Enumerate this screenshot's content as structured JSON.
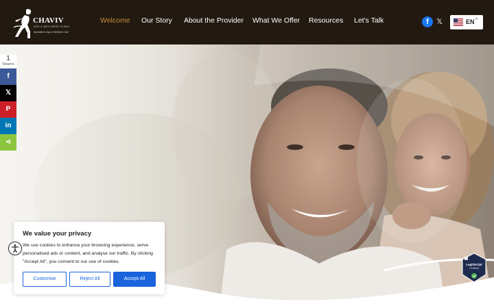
{
  "header": {
    "brand": "CHAVIV",
    "brand_sub1": "AGE & WELLNESS CLINIC",
    "brand_sub2": "Specialist in Age & Wellness Care",
    "nav": [
      {
        "label": "Welcome",
        "active": true
      },
      {
        "label": "Our Story",
        "active": false
      },
      {
        "label": "About the Provider",
        "active": false
      },
      {
        "label": "What We Offer",
        "active": false
      },
      {
        "label": "Resources",
        "active": false
      },
      {
        "label": "Let's Talk",
        "active": false
      }
    ],
    "social": {
      "facebook_glyph": "f",
      "x_glyph": "𝕏"
    },
    "language": {
      "code": "EN",
      "flag_icon": "us-flag-icon",
      "caret": "^"
    }
  },
  "share_bar": {
    "count": "1",
    "count_label": "Shares",
    "buttons": [
      {
        "icon": "facebook-icon",
        "glyph": "f",
        "color": "#3b5998"
      },
      {
        "icon": "x-icon",
        "glyph": "𝕏",
        "color": "#000000"
      },
      {
        "icon": "pinterest-icon",
        "glyph": "P",
        "color": "#cb2027"
      },
      {
        "icon": "linkedin-icon",
        "glyph": "in",
        "color": "#0077b5"
      },
      {
        "icon": "share-icon",
        "glyph": "⋖",
        "color": "#8cc63f"
      }
    ]
  },
  "cookie": {
    "title": "We value your privacy",
    "body": "We use cookies to enhance your browsing experience, serve personalised ads or content, and analyse our traffic. By clicking \"Accept All\", you consent to our use of cookies.",
    "customise": "Customise",
    "reject": "Reject All",
    "accept": "Accept All"
  },
  "badge": {
    "line1": "LegitScript",
    "line2": "Certified"
  },
  "colors": {
    "header_bg": "#221a11",
    "nav_active": "#c98c3c",
    "cookie_accent": "#1863dc"
  }
}
